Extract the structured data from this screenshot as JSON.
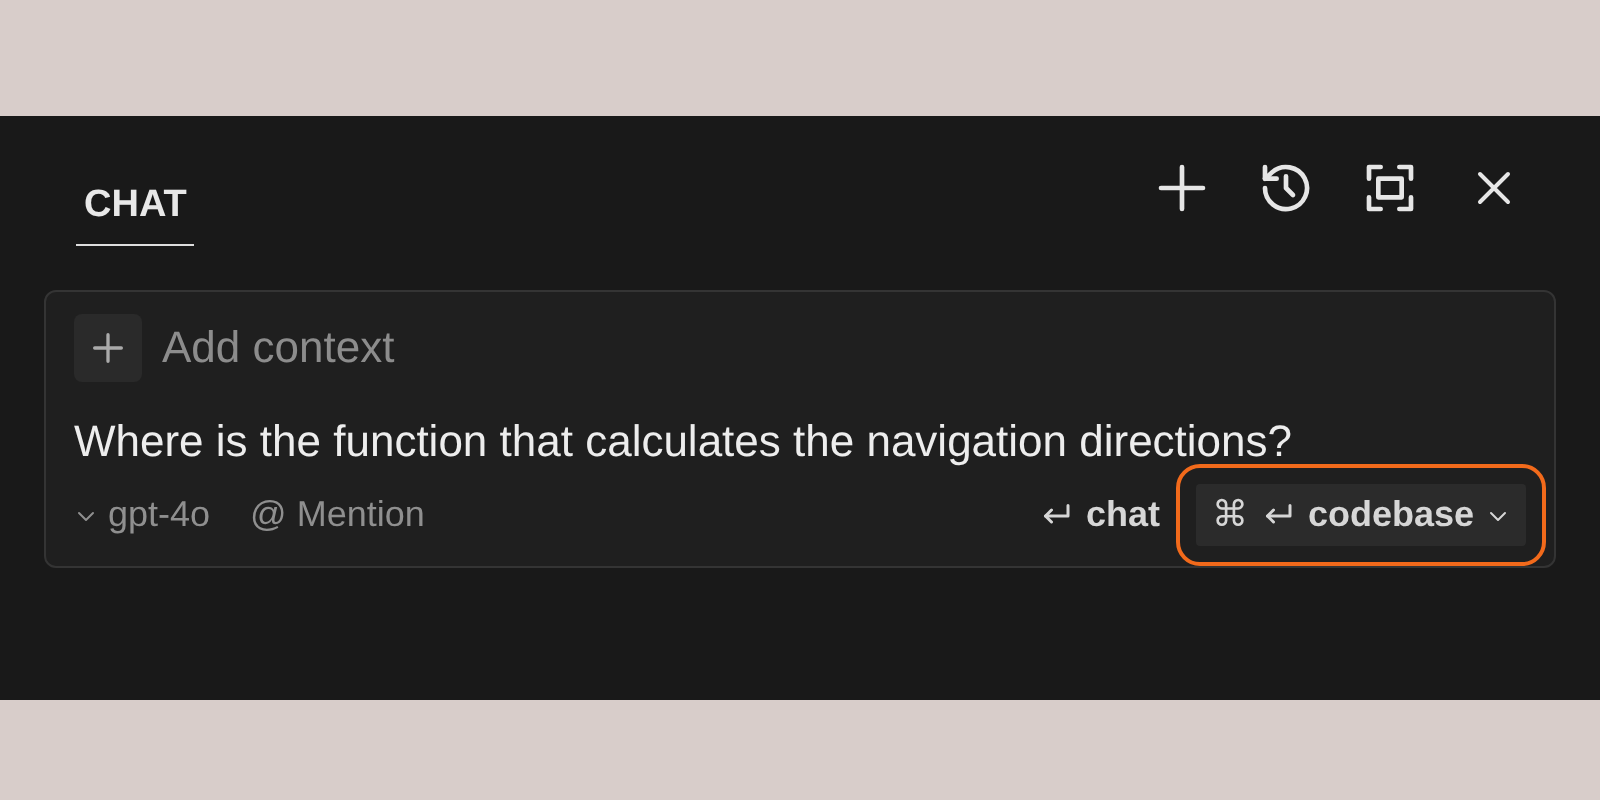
{
  "tabs": [
    {
      "label": "CHAT",
      "selected": true
    }
  ],
  "toolbar": [
    {
      "kind": "new"
    },
    {
      "kind": "history"
    },
    {
      "kind": "maximize"
    },
    {
      "kind": "close"
    }
  ],
  "composer": {
    "add_context": "Add context",
    "message": "Where is the function that calculates the navigation directions?",
    "model": "gpt-4o",
    "mention": {
      "symbol": "@",
      "label": "Mention"
    },
    "actions": [
      {
        "kind": "chat",
        "label": "chat",
        "highlighted": false
      },
      {
        "kind": "codebase",
        "modifier": "⌘",
        "label": "codebase",
        "highlighted": true
      }
    ]
  }
}
